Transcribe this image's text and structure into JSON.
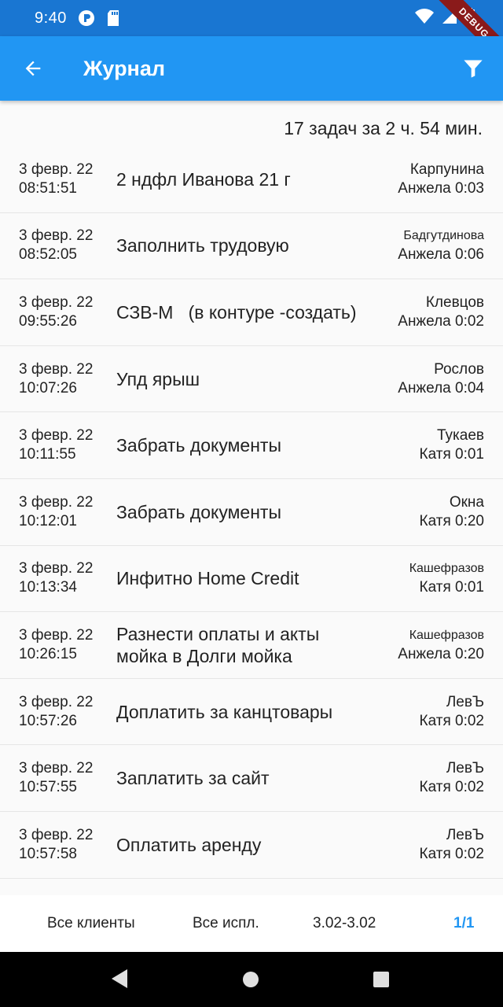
{
  "status_bar": {
    "time": "9:40",
    "debug_label": "DEBUG",
    "icons": [
      "pocket-icon",
      "sd-card-icon",
      "wifi-icon",
      "signal-icon",
      "battery-icon"
    ]
  },
  "app_bar": {
    "title": "Журнал",
    "back_icon": "arrow-back-icon",
    "filter_icon": "filter-icon",
    "color": "#2196f3",
    "status_color": "#1976d2"
  },
  "summary": "17  задач за 2 ч. 54 мин.",
  "tasks": [
    {
      "date": "3 февр. 22",
      "time": "08:51:51",
      "task": "2 ндфл Иванова 21 г",
      "client": "Карпунина",
      "assignee": "Анжела 0:03"
    },
    {
      "date": "3 февр. 22",
      "time": "08:52:05",
      "task": "Заполнить трудовую",
      "client": "Бадгутдинова",
      "assignee": "Анжела 0:06"
    },
    {
      "date": "3 февр. 22",
      "time": "09:55:26",
      "task": "СЗВ-М   (в контуре -создать)",
      "client": "Клевцов",
      "assignee": "Анжела 0:02"
    },
    {
      "date": "3 февр. 22",
      "time": "10:07:26",
      "task": "Упд ярыш",
      "client": "Рослов",
      "assignee": "Анжела 0:04"
    },
    {
      "date": "3 февр. 22",
      "time": "10:11:55",
      "task": "Забрать документы",
      "client": "Тукаев",
      "assignee": "Катя 0:01"
    },
    {
      "date": "3 февр. 22",
      "time": "10:12:01",
      "task": "Забрать документы",
      "client": "Окна",
      "assignee": "Катя 0:20"
    },
    {
      "date": "3 февр. 22",
      "time": "10:13:34",
      "task": "Инфитно Home Credit",
      "client": "Кашефразов",
      "assignee": "Катя 0:01"
    },
    {
      "date": "3 февр. 22",
      "time": "10:26:15",
      "task": "Разнести оплаты и акты мойка в Долги мойка",
      "client": "Кашефразов",
      "assignee": "Анжела 0:20"
    },
    {
      "date": "3 февр. 22",
      "time": "10:57:26",
      "task": "Доплатить за канцтовары",
      "client": "ЛевЪ",
      "assignee": "Катя 0:02"
    },
    {
      "date": "3 февр. 22",
      "time": "10:57:55",
      "task": "Заплатить за сайт",
      "client": "ЛевЪ",
      "assignee": "Катя 0:02"
    },
    {
      "date": "3 февр. 22",
      "time": "10:57:58",
      "task": "Оплатить аренду",
      "client": "ЛевЪ",
      "assignee": "Катя 0:02"
    }
  ],
  "bottom_bar": {
    "clients": "Все клиенты",
    "executors": "Все испл.",
    "date_range": "3.02-3.02",
    "page": "1/1"
  },
  "nav_bar": {
    "icons": [
      "back-triangle-icon",
      "home-circle-icon",
      "recents-square-icon"
    ]
  }
}
